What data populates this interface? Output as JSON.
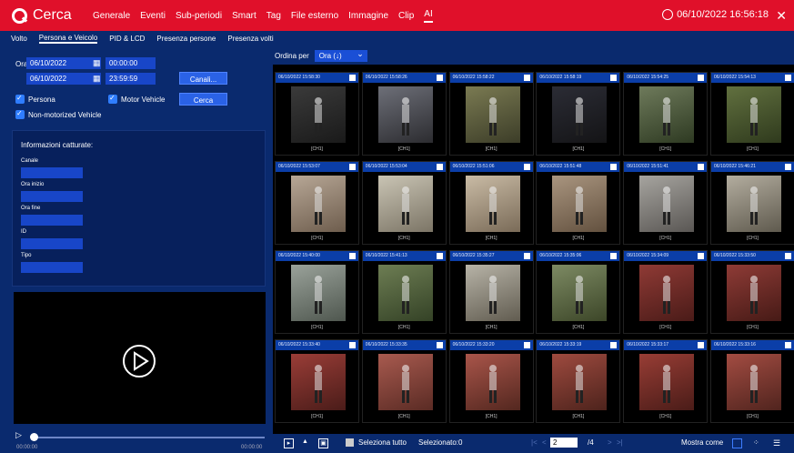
{
  "app": {
    "title": "Cerca"
  },
  "nav": [
    {
      "label": "Generale"
    },
    {
      "label": "Eventi"
    },
    {
      "label": "Sub-periodi"
    },
    {
      "label": "Smart"
    },
    {
      "label": "Tag"
    },
    {
      "label": "File esterno"
    },
    {
      "label": "Immagine"
    },
    {
      "label": "Clip"
    },
    {
      "label": "AI"
    }
  ],
  "datetime": "06/10/2022 16:56:18",
  "subtabs": [
    {
      "label": "Volto"
    },
    {
      "label": "Persona e Veicolo"
    },
    {
      "label": "PID & LCD"
    },
    {
      "label": "Presenza persone"
    },
    {
      "label": "Presenza volti"
    }
  ],
  "search": {
    "ora_label": "Ora",
    "start_date": "06/10/2022",
    "start_time": "00:00:00",
    "end_date": "06/10/2022",
    "end_time": "23:59:59",
    "channels_button": "Canali...",
    "cerca_button": "Cerca",
    "checkboxes": [
      {
        "label": "Persona"
      },
      {
        "label": "Motor Vehicle"
      },
      {
        "label": "Non-motorized Vehicle"
      }
    ]
  },
  "info": {
    "title": "Informazioni catturate:",
    "fields": [
      {
        "label": "Canale"
      },
      {
        "label": "Ora inizio"
      },
      {
        "label": "Ora fine"
      },
      {
        "label": "ID"
      },
      {
        "label": "Tipo"
      }
    ]
  },
  "player": {
    "start": "00:00:00",
    "end": "00:00:00"
  },
  "sort": {
    "label": "Ordina per",
    "value": "Ora (↓)"
  },
  "thumbs": [
    {
      "time": "06/10/2022 15:58:30",
      "ch": "[CH1]"
    },
    {
      "time": "06/10/2022 15:58:26",
      "ch": "[CH1]"
    },
    {
      "time": "06/10/2022 15:58:22",
      "ch": "[CH1]"
    },
    {
      "time": "06/10/2022 15:58:19",
      "ch": "[CH1]"
    },
    {
      "time": "06/10/2022 15:54:25",
      "ch": "[CH1]"
    },
    {
      "time": "06/10/2022 15:54:13",
      "ch": "[CH1]"
    },
    {
      "time": "06/10/2022 15:53:07",
      "ch": "[CH1]"
    },
    {
      "time": "06/10/2022 15:53:04",
      "ch": "[CH1]"
    },
    {
      "time": "06/10/2022 15:51:06",
      "ch": "[CH1]"
    },
    {
      "time": "06/10/2022 15:51:48",
      "ch": "[CH1]"
    },
    {
      "time": "06/10/2022 15:51:41",
      "ch": "[CH1]"
    },
    {
      "time": "06/10/2022 15:46:21",
      "ch": "[CH1]"
    },
    {
      "time": "06/10/2022 15:40:00",
      "ch": "[CH1]"
    },
    {
      "time": "06/10/2022 15:41:13",
      "ch": "[CH1]"
    },
    {
      "time": "06/10/2022 15:35:27",
      "ch": "[CH1]"
    },
    {
      "time": "06/10/2022 15:35:06",
      "ch": "[CH1]"
    },
    {
      "time": "06/10/2022 15:34:09",
      "ch": "[CH1]"
    },
    {
      "time": "06/10/2022 15:33:50",
      "ch": "[CH1]"
    },
    {
      "time": "06/10/2022 15:33:40",
      "ch": "[CH1]"
    },
    {
      "time": "06/10/2022 15:33:35",
      "ch": "[CH1]"
    },
    {
      "time": "06/10/2022 15:33:20",
      "ch": "[CH1]"
    },
    {
      "time": "06/10/2022 15:33:19",
      "ch": "[CH1]"
    },
    {
      "time": "06/10/2022 15:33:17",
      "ch": "[CH1]"
    },
    {
      "time": "06/10/2022 15:33:16",
      "ch": "[CH1]"
    }
  ],
  "footer": {
    "select_all": "Seleziona tutto",
    "selected": "Selezionato:0",
    "page": "2",
    "total": "/4",
    "mostra": "Mostra come"
  },
  "colors": {
    "accent": "#e0102a",
    "bg": "#0a2a6e"
  }
}
